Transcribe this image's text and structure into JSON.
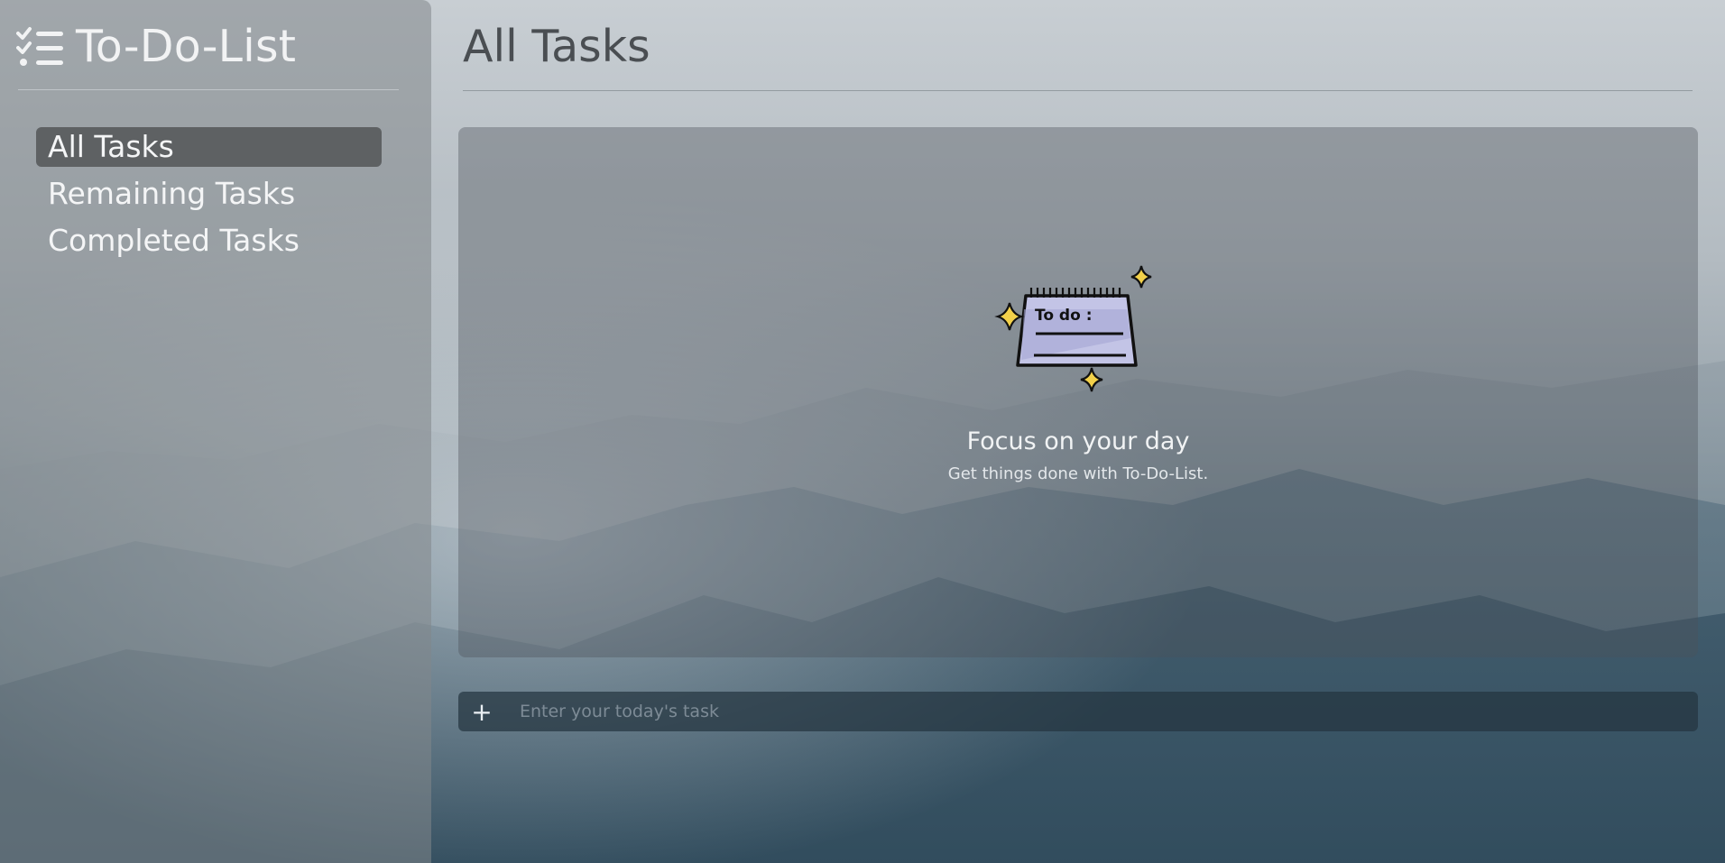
{
  "app": {
    "name": "To-Do-List",
    "logo_icon": "checklist-icon"
  },
  "sidebar": {
    "items": [
      {
        "label": "All Tasks",
        "active": true
      },
      {
        "label": "Remaining Tasks",
        "active": false
      },
      {
        "label": "Completed Tasks",
        "active": false
      }
    ]
  },
  "main": {
    "title": "All Tasks",
    "empty_state": {
      "illustration": "todo-notepad-illustration",
      "illustration_text": "To do :",
      "title": "Focus on your day",
      "subtitle": "Get things done with To-Do-List."
    },
    "add_task": {
      "icon": "plus-icon",
      "placeholder": "Enter your today's task",
      "value": ""
    }
  },
  "colors": {
    "sidebar_active": "#464a4d",
    "sparkle": "#f3d14a",
    "notepad": "#c3c4e6"
  }
}
